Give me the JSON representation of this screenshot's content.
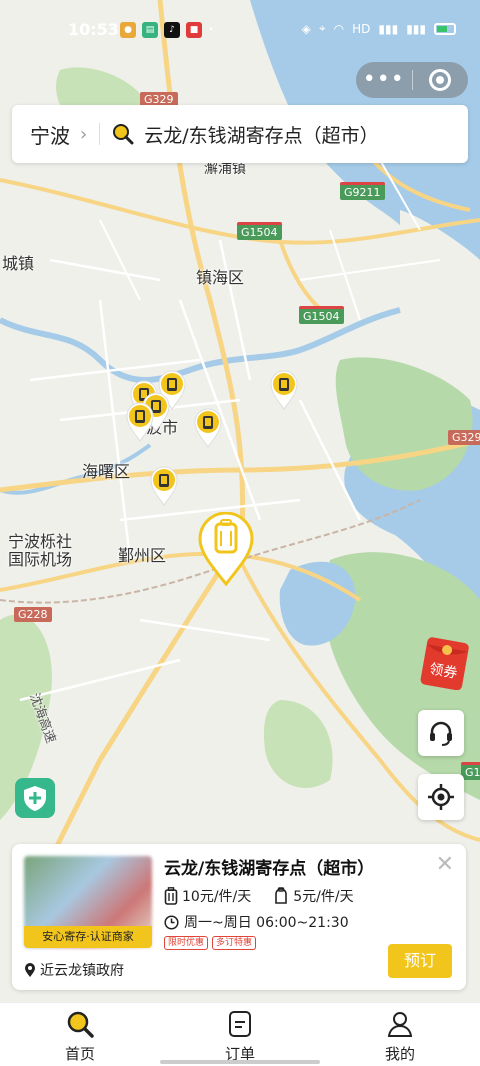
{
  "status_bar": {
    "time": "10:53",
    "right_text": "HD"
  },
  "search": {
    "city": "宁波",
    "query": "云龙/东钱湖寄存点（超市）"
  },
  "map": {
    "labels": {
      "haipu": "澥浦镇",
      "cheng": "城镇",
      "zhenhai": "镇海区",
      "city": "宁波市",
      "haishu": "海曙区",
      "airport_line1": "宁波栎社",
      "airport_line2": "国际机场",
      "yinzhou": "鄞州区",
      "expressway": "沈海高速"
    },
    "road_shields": {
      "g329_top": "G329",
      "g9211": "G9211",
      "g1504_a": "G1504",
      "g1504_b": "G1504",
      "g329_right": "G329",
      "g228": "G228",
      "g1_right": "G1"
    }
  },
  "coupon": {
    "label": "领券"
  },
  "card": {
    "title": "云龙/东钱湖寄存点（超市）",
    "thumb_label": "安心寄存·认证商家",
    "price_large": "10元/件/天",
    "price_small": "5元/件/天",
    "hours": "周一~周日 06:00~21:30",
    "tags": [
      "限时优惠",
      "多订特惠"
    ],
    "address": "近云龙镇政府",
    "book_label": "预订"
  },
  "tabs": [
    {
      "label": "首页",
      "icon": "search-icon",
      "active": true
    },
    {
      "label": "订单",
      "icon": "order-icon",
      "active": false
    },
    {
      "label": "我的",
      "icon": "profile-icon",
      "active": false
    }
  ],
  "colors": {
    "accent": "#f2c51c",
    "sea": "#a5cbe8",
    "green_area": "#b5d9a8"
  }
}
